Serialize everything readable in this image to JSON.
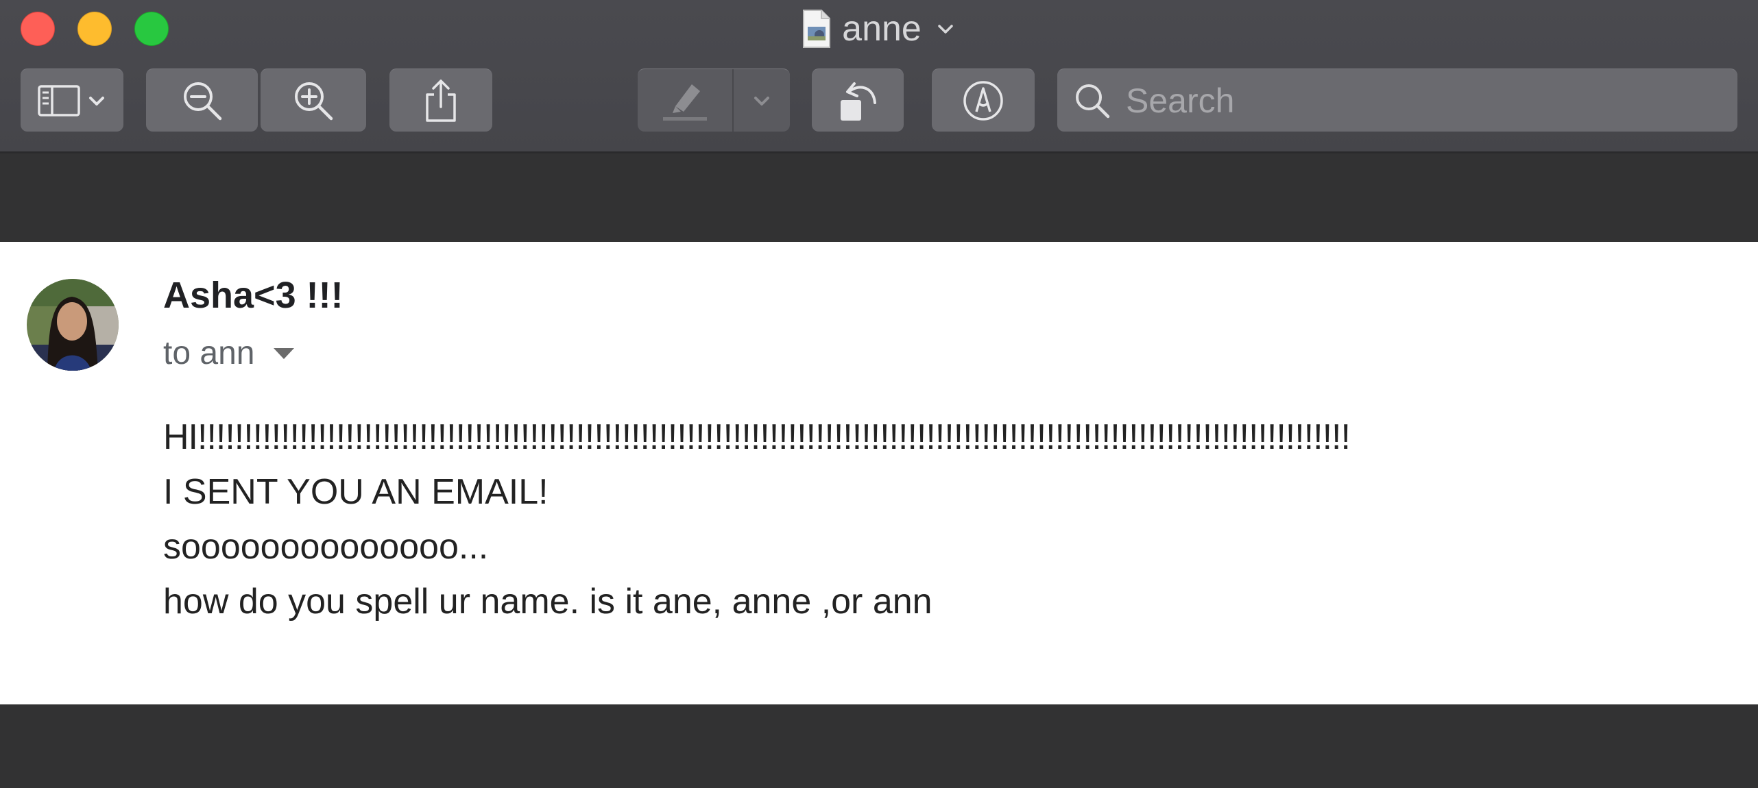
{
  "window": {
    "title": "anne",
    "file_icon": "image-file-icon"
  },
  "toolbar": {
    "buttons": [
      {
        "name": "sidebar-toggle",
        "icon": "sidebar-icon"
      },
      {
        "name": "zoom-out",
        "icon": "zoom-out-icon"
      },
      {
        "name": "zoom-in",
        "icon": "zoom-in-icon"
      },
      {
        "name": "share",
        "icon": "share-icon"
      },
      {
        "name": "highlight",
        "icon": "highlighter-icon",
        "enabled": false
      },
      {
        "name": "rotate",
        "icon": "rotate-left-icon"
      },
      {
        "name": "markup",
        "icon": "markup-icon"
      }
    ],
    "search": {
      "placeholder": "Search",
      "value": ""
    }
  },
  "email": {
    "sender": "Asha<3 !!!",
    "recipient": "to ann",
    "body": [
      "HI!!!!!!!!!!!!!!!!!!!!!!!!!!!!!!!!!!!!!!!!!!!!!!!!!!!!!!!!!!!!!!!!!!!!!!!!!!!!!!!!!!!!!!!!!!!!!!!!!!!!!!!!!!!!!!!!!!!!!!!!!!!!!",
      "I SENT YOU AN EMAIL!",
      "soooooooooooooo...",
      "how do you spell ur name. is it ane, anne ,or ann"
    ]
  },
  "colors": {
    "close": "#fe5f57",
    "minimize": "#febc2e",
    "maximize": "#28c840",
    "toolbar_bg": "#4a4a4f",
    "viewport_bg": "#323233"
  }
}
